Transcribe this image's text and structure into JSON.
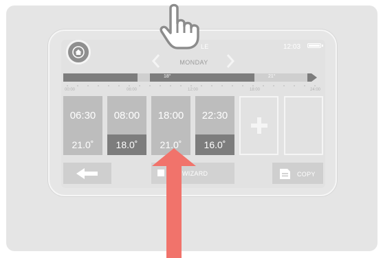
{
  "header": {
    "title_partial": "LE",
    "clock": "12:03",
    "day": "MONDAY"
  },
  "timeline": {
    "segments": [
      {
        "label": "",
        "color": "#7d7d7d"
      },
      {
        "label": "",
        "color": "#cfcfcf"
      },
      {
        "label": "18°",
        "color": "#7d7d7d"
      },
      {
        "label": "21°",
        "color": "#cfcfcf"
      },
      {
        "label": "",
        "color": "#7d7d7d"
      }
    ],
    "ticks": [
      "00:00",
      "06:00",
      "12:00",
      "18:00",
      "24:00"
    ]
  },
  "schedule": [
    {
      "time": "06:30",
      "temp": "21.0˚",
      "temp_color": "#bdbdbd"
    },
    {
      "time": "08:00",
      "temp": "18.0˚",
      "temp_color": "#7d7d7d"
    },
    {
      "time": "18:00",
      "temp": "21.0˚",
      "temp_color": "#bdbdbd"
    },
    {
      "time": "22:30",
      "temp": "16.0˚",
      "temp_color": "#7d7d7d"
    }
  ],
  "buttons": {
    "wizard": "WIZARD",
    "copy": "COPY"
  },
  "icons": [
    "home-icon",
    "chevron-left-icon",
    "chevron-right-icon",
    "plus-icon",
    "arrow-left-icon",
    "wizard-icon",
    "copy-icon",
    "pointing-hand-icon",
    "up-arrow-icon"
  ],
  "colors": {
    "annotation_arrow": "#f1736b"
  }
}
